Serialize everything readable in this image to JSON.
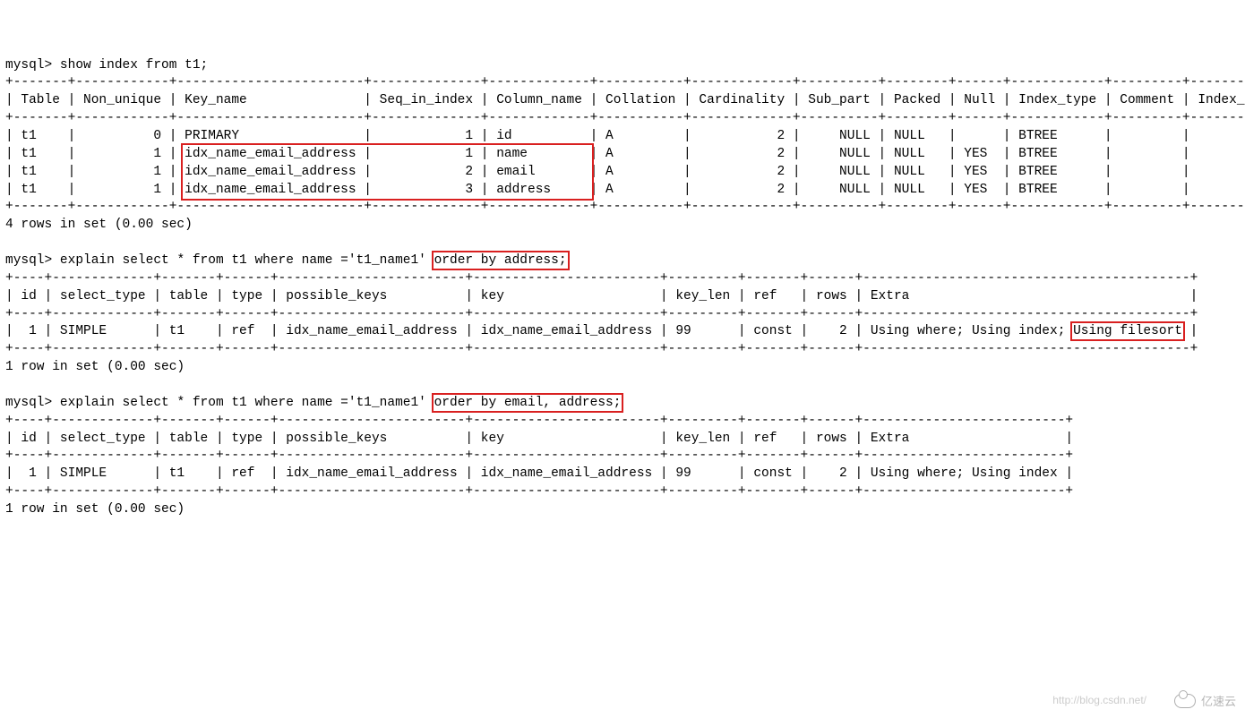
{
  "prompt": "mysql>",
  "cmd1": "show index from t1;",
  "idx_border_top": "+-------+------------+------------------------+--------------+-------------+-----------+-------------+----------+--------+------+------------+---------+---------------+",
  "idx_header1": "| Table | Non_unique | Key_name               | Seq_in_index | Column_name | Collation | Cardinality | Sub_part | Packed | Null | Index_type | Comment | Index_comment |",
  "idx_rows": [
    "| t1    |          0 | PRIMARY                |            1 | id          | A         |           2 |     NULL | NULL   |      | BTREE      |         |               |",
    "| t1    |          1 | idx_name_email_address |            1 | name        | A         |           2 |     NULL | NULL   | YES  | BTREE      |         |               |",
    "| t1    |          1 | idx_name_email_address |            2 | email       | A         |           2 |     NULL | NULL   | YES  | BTREE      |         |               |",
    "| t1    |          1 | idx_name_email_address |            3 | address     | A         |           2 |     NULL | NULL   | YES  | BTREE      |         |               |"
  ],
  "rows4": "4 rows in set (0.00 sec)",
  "cmd2_a": "explain select * from t1 where name ='t1_name1' ",
  "cmd2_b": "order by address;",
  "exp1_border": "+----+-------------+-------+------+------------------------+------------------------+---------+-------+------+------------------------------------------+",
  "exp1_header": "| id | select_type | table | type | possible_keys          | key                    | key_len | ref   | rows | Extra                                    |",
  "exp1_row_a": "|  1 | SIMPLE      | t1    | ref  | idx_name_email_address | idx_name_email_address | 99      | const |    2 | Using where; Using index; ",
  "exp1_row_b": "Using filesort",
  "exp1_row_c": " |",
  "row1": "1 row in set (0.00 sec)",
  "cmd3_a": "explain select * from t1 where name ='t1_name1' ",
  "cmd3_b": "order by email, address;",
  "exp2_border": "+----+-------------+-------+------+------------------------+------------------------+---------+-------+------+--------------------------+",
  "exp2_header": "| id | select_type | table | type | possible_keys          | key                    | key_len | ref   | rows | Extra                    |",
  "exp2_row": "|  1 | SIMPLE      | t1    | ref  | idx_name_email_address | idx_name_email_address | 99      | const |    2 | Using where; Using index |",
  "watermark_site": "亿速云",
  "watermark_url": "http://blog.csdn.net/"
}
